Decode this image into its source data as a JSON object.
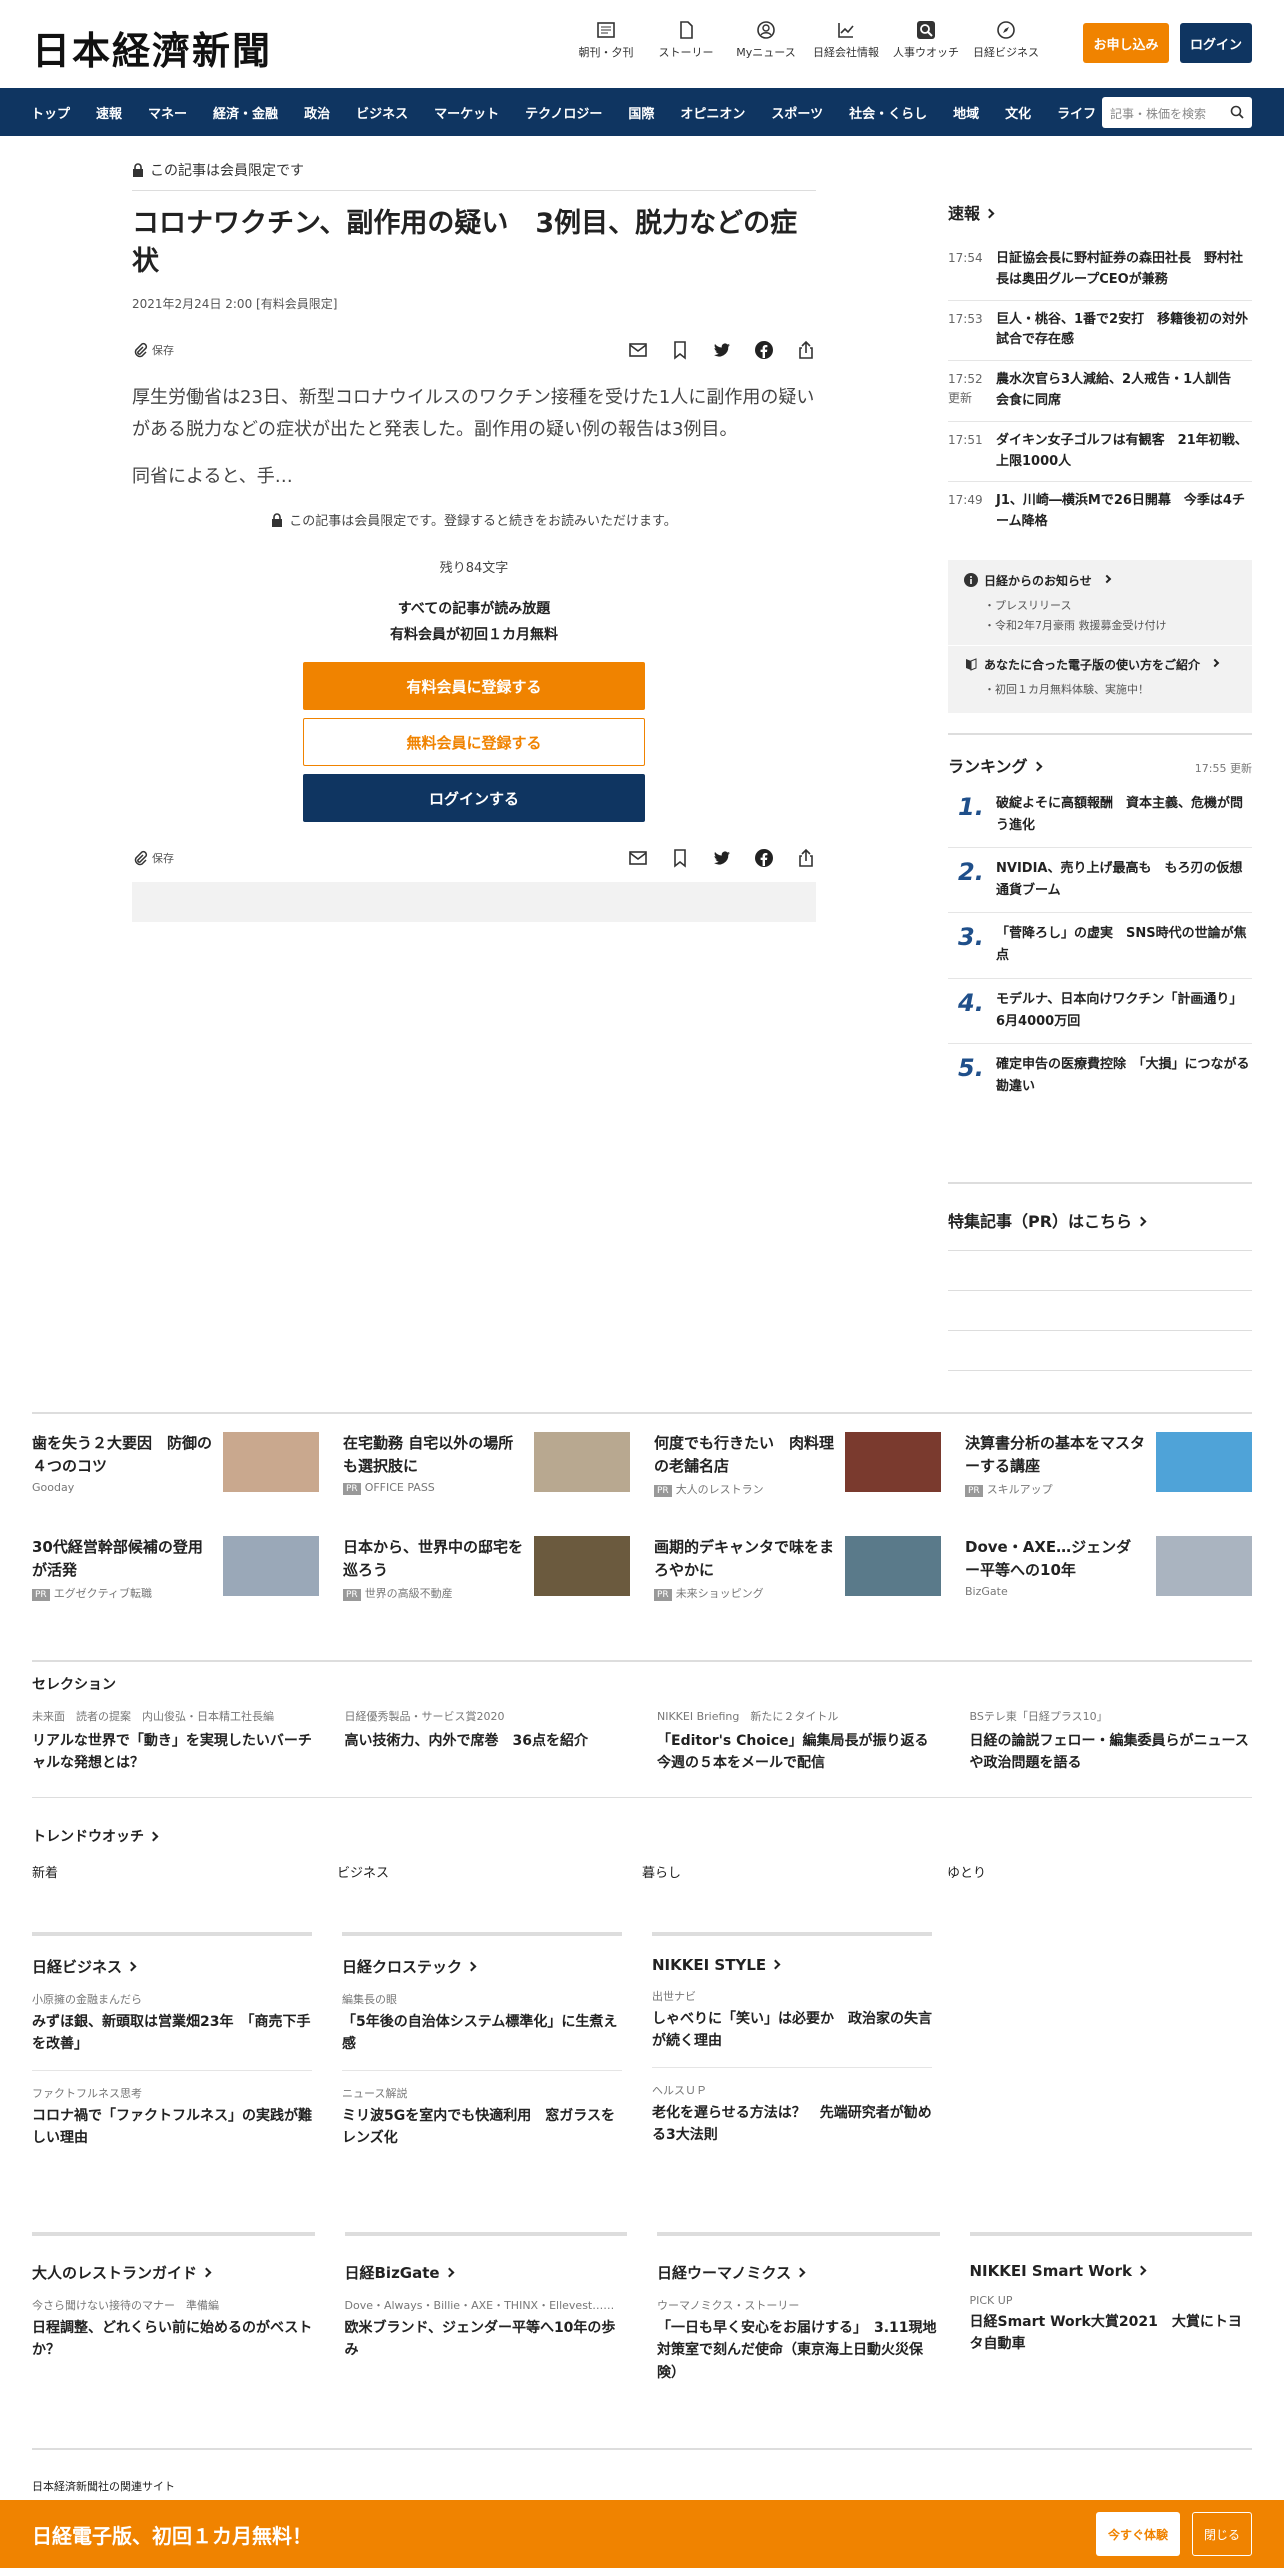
{
  "header": {
    "logo": "日本経濟新聞",
    "icons": [
      {
        "label": "朝刊・夕刊",
        "icon": "newspaper-icon"
      },
      {
        "label": "ストーリー",
        "icon": "document-icon"
      },
      {
        "label": "Myニュース",
        "icon": "user-icon"
      },
      {
        "label": "日経会社情報",
        "icon": "chart-icon"
      },
      {
        "label": "人事ウオッチ",
        "icon": "search-icon"
      },
      {
        "label": "日経ビジネス",
        "icon": "compass-icon"
      }
    ],
    "apply": "お申し込み",
    "login": "ログイン"
  },
  "nav": {
    "items": [
      "トップ",
      "速報",
      "マネー",
      "経済・金融",
      "政治",
      "ビジネス",
      "マーケット",
      "テクノロジー",
      "国際",
      "オピニオン",
      "スポーツ",
      "社会・くらし",
      "地域",
      "文化",
      "ライフ"
    ],
    "search_placeholder": "記事・株価を検索"
  },
  "article": {
    "member_label": "この記事は会員限定です",
    "title": "コロナワクチン、副作用の疑い　3例目、脱力などの症状",
    "date": "2021年2月24日 2:00 [有料会員限定]",
    "save": "保存",
    "body1": "厚生労働省は23日、新型コロナウイルスのワクチン接種を受けた1人に副作用の疑いがある脱力などの症状が出たと発表した。副作用の疑い例の報告は3例目。",
    "body2": "同省によると、手…",
    "paywall": {
      "note": "この記事は会員限定です。登録すると続きをお読みいただけます。",
      "remaining": "残り84文字",
      "line1": "すべての記事が読み放題",
      "line2": "有料会員が初回１カ月無料",
      "paid": "有料会員に登録する",
      "free": "無料会員に登録する",
      "login": "ログインする"
    }
  },
  "sidebar": {
    "sokuho_title": "速報",
    "sokuho": [
      {
        "time": "17:54",
        "text": "日証協会長に野村証券の森田社長　野村社長は奥田グループCEOが兼務"
      },
      {
        "time": "17:53",
        "text": "巨人・桃谷、1番で2安打　移籍後初の対外試合で存在感"
      },
      {
        "time": "17:52\n更新",
        "text": "農水次官ら3人減給、2人戒告・1人訓告　会食に同席"
      },
      {
        "time": "17:51",
        "text": "ダイキン女子ゴルフは有観客　21年初戦、上限1000人"
      },
      {
        "time": "17:49",
        "text": "J1、川崎―横浜Mで26日開幕　今季は4チーム降格"
      }
    ],
    "notice_title": "日経からのお知らせ",
    "notice_items": [
      "プレスリリース",
      "令和2年7月豪雨 救援募金受け付け"
    ],
    "guide_title": "あなたに合った電子版の使い方をご紹介",
    "guide_items": [
      "初回１カ月無料体験、実施中！"
    ],
    "ranking_title": "ランキング",
    "ranking_updated": "17:55  更新",
    "ranking": [
      {
        "n": "1.",
        "text": "破綻よそに高額報酬　資本主義、危機が問う進化"
      },
      {
        "n": "2.",
        "text": "NVIDIA、売り上げ最高も　もろ刃の仮想通貨ブーム"
      },
      {
        "n": "3.",
        "text": "「菅降ろし」の虚実　SNS時代の世論が焦点"
      },
      {
        "n": "4.",
        "text": "モデルナ、日本向けワクチン「計画通り」　6月4000万回"
      },
      {
        "n": "5.",
        "text": "確定申告の医療費控除　「大損」につながる勘違い"
      }
    ],
    "tokushu": "特集記事（PR）はこちら"
  },
  "ads": [
    {
      "title": "歯を失う２大要因　防御の４つのコツ",
      "src": "Gooday",
      "pr": false,
      "img": "#c9a88e"
    },
    {
      "title": "在宅勤務 自宅以外の場所も選択肢に",
      "src": "OFFICE PASS",
      "pr": true,
      "img": "#b8a890"
    },
    {
      "title": "何度でも行きたい　肉料理の老舗名店",
      "src": "大人のレストラン",
      "pr": true,
      "img": "#7a3a2e"
    },
    {
      "title": "決算書分析の基本をマスターする講座",
      "src": "スキルアップ",
      "pr": true,
      "img": "#4fa3d8"
    },
    {
      "title": "30代経営幹部候補の登用が活発",
      "src": "エグゼクティブ転職",
      "pr": true,
      "img": "#9aa8b8"
    },
    {
      "title": "日本から、世界中の邸宅を巡ろう",
      "src": "世界の高級不動産",
      "pr": true,
      "img": "#6b5a3e"
    },
    {
      "title": "画期的デキャンタで味をまろやかに",
      "src": "未来ショッピング",
      "pr": true,
      "img": "#5a7a8a"
    },
    {
      "title": "Dove・AXE…ジェンダー平等への10年",
      "src": "BizGate",
      "pr": false,
      "img": "#aab4c0"
    }
  ],
  "selection": {
    "title": "セレクション",
    "items": [
      {
        "k": "未来面　読者の提案　内山俊弘・日本精工社長編",
        "v": "リアルな世界で「動き」を実現したいバーチャルな発想とは？"
      },
      {
        "k": "日経優秀製品・サービス賞2020",
        "v": "高い技術力、内外で席巻　36点を紹介"
      },
      {
        "k": "NIKKEI Briefing　新たに２タイトル",
        "v": "「Editor's Choice」編集局長が振り返る今週の５本をメールで配信"
      },
      {
        "k": "BSテレ東「日経プラス10」",
        "v": "日経の論説フェロー・編集委員らがニュースや政治問題を語る"
      }
    ]
  },
  "trend": {
    "title": "トレンドウオッチ",
    "cats": [
      "新着",
      "ビジネス",
      "暮らし",
      "ゆとり"
    ]
  },
  "pubs": [
    {
      "title": "日経ビジネス",
      "k1": "小原擁の金融まんだら",
      "v1": "みずほ銀、新頭取は営業畑23年　「商売下手を改善」",
      "k2": "ファクトフルネス思考",
      "v2": "コロナ禍で「ファクトフルネス」の実践が難しい理由"
    },
    {
      "title": "日経クロステック",
      "k1": "編集長の眼",
      "v1": "「5年後の自治体システム標準化」に生煮え感",
      "k2": "ニュース解説",
      "v2": "ミリ波5Gを室内でも快適利用　窓ガラスをレンズ化"
    },
    {
      "title": "NIKKEI STYLE",
      "k1": "出世ナビ",
      "v1": "しゃべりに「笑い」は必要か　政治家の失言が続く理由",
      "k2": "ヘルスＵＰ",
      "v2": "老化を遅らせる方法は？　先端研究者が勧める3大法則"
    }
  ],
  "pubs2": [
    {
      "title": "大人のレストランガイド",
      "k": "今さら聞けない接待のマナー　準備編",
      "v": "日程調整、どれくらい前に始めるのがベストか？"
    },
    {
      "title": "日経BizGate",
      "k": "Dove・Always・Billie・AXE・THINX・Ellevest……",
      "v": "欧米ブランド、ジェンダー平等へ10年の歩み"
    },
    {
      "title": "日経ウーマノミクス",
      "k": "ウーマノミクス・ストーリー",
      "v": "「一日も早く安心をお届けする」　3.11現地対策室で刻んだ使命（東京海上日動火災保険）"
    },
    {
      "title": "NIKKEI Smart Work",
      "k": "PICK UP",
      "v": "日経Smart Work大賞2021　大賞にトヨタ自動車"
    }
  ],
  "footer": {
    "related": "日本経済新聞社の関連サイト"
  },
  "promo": {
    "text": "日経電子版、初回１カ月無料！",
    "try": "今すぐ体験",
    "close": "閉じる"
  }
}
